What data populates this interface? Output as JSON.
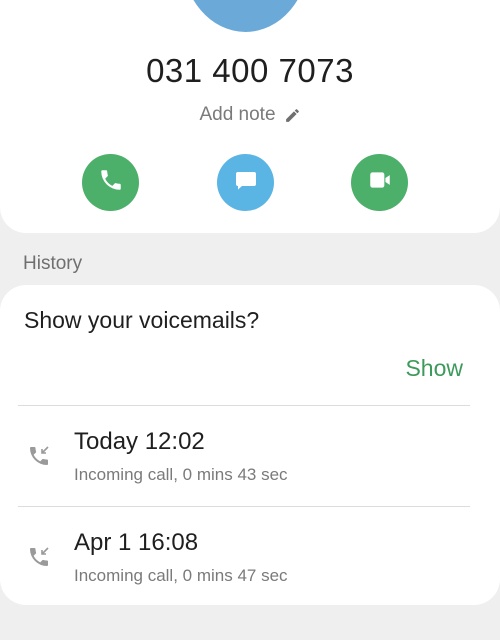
{
  "contact": {
    "phone_number": "031 400 7073",
    "add_note_label": "Add note"
  },
  "actions": [
    {
      "name": "call",
      "icon": "phone-icon",
      "color": "#4caf6a"
    },
    {
      "name": "message",
      "icon": "message-icon",
      "color": "#5ab4e4"
    },
    {
      "name": "video",
      "icon": "video-icon",
      "color": "#4caf6a"
    }
  ],
  "history": {
    "label": "History",
    "voicemail_prompt": "Show your voicemails?",
    "show_label": "Show",
    "calls": [
      {
        "title": "Today 12:02",
        "subtitle": "Incoming call, 0 mins 43 sec",
        "icon": "incoming-call-icon"
      },
      {
        "title": "Apr 1 16:08",
        "subtitle": "Incoming call, 0 mins 47 sec",
        "icon": "incoming-call-icon"
      }
    ]
  },
  "colors": {
    "accent_green": "#3d9a5b",
    "call_green": "#4caf6a",
    "message_blue": "#5ab4e4",
    "avatar_blue": "#6ba9d8"
  }
}
